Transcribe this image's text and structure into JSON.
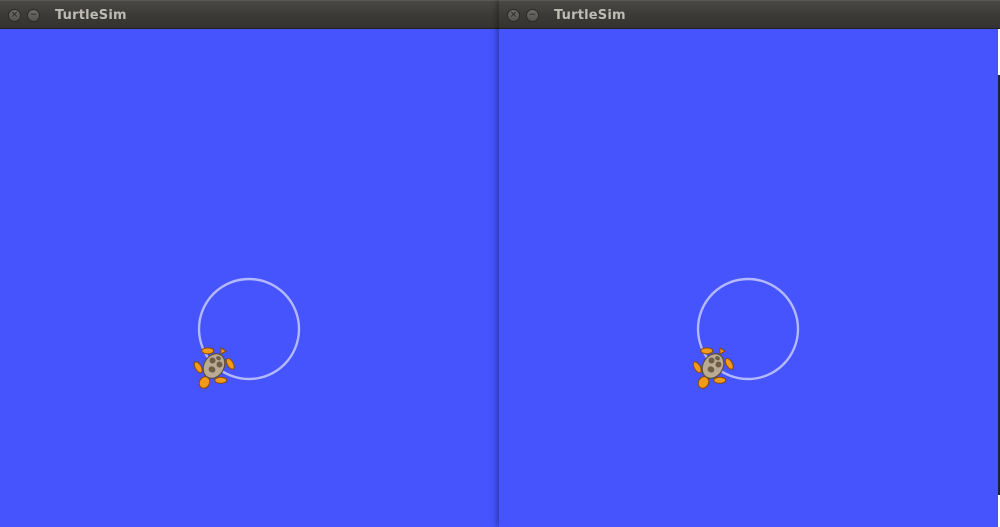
{
  "windows": [
    {
      "title": "TurtleSim",
      "close_glyph": "×",
      "minimize_glyph": "−",
      "background_color": "#4554fd",
      "pen_color": "#b3b8ff",
      "turtle_icon": "turtle-icon"
    },
    {
      "title": "TurtleSim",
      "close_glyph": "×",
      "minimize_glyph": "−",
      "background_color": "#4554fd",
      "pen_color": "#b3b8ff",
      "turtle_icon": "turtle-icon"
    }
  ]
}
